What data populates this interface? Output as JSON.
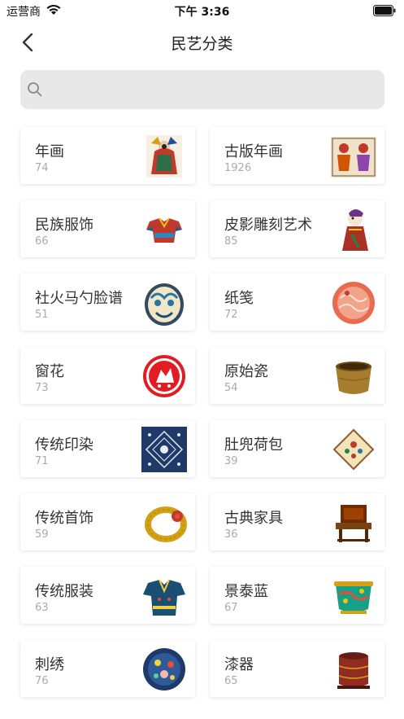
{
  "status_bar": {
    "carrier": "运营商",
    "time": "下午 3:36"
  },
  "nav": {
    "title": "民艺分类",
    "back_icon": "chevron-left-icon"
  },
  "search": {
    "placeholder": "",
    "icon": "search-icon"
  },
  "categories": [
    {
      "name": "年画",
      "count": "74",
      "thumb": "new-year-painting"
    },
    {
      "name": "古版年画",
      "count": "1926",
      "thumb": "ancient-woodblock-print"
    },
    {
      "name": "民族服饰",
      "count": "66",
      "thumb": "ethnic-costume"
    },
    {
      "name": "皮影雕刻艺术",
      "count": "85",
      "thumb": "shadow-puppet"
    },
    {
      "name": "社火马勺脸谱",
      "count": "51",
      "thumb": "ladle-mask"
    },
    {
      "name": "纸笺",
      "count": "72",
      "thumb": "paper-letter"
    },
    {
      "name": "窗花",
      "count": "73",
      "thumb": "paper-cut"
    },
    {
      "name": "原始瓷",
      "count": "54",
      "thumb": "primitive-porcelain"
    },
    {
      "name": "传统印染",
      "count": "71",
      "thumb": "indigo-print"
    },
    {
      "name": "肚兜荷包",
      "count": "39",
      "thumb": "pouch"
    },
    {
      "name": "传统首饰",
      "count": "59",
      "thumb": "bracelet"
    },
    {
      "name": "古典家具",
      "count": "36",
      "thumb": "chair"
    },
    {
      "name": "传统服装",
      "count": "63",
      "thumb": "robe"
    },
    {
      "name": "景泰蓝",
      "count": "67",
      "thumb": "cloisonne"
    },
    {
      "name": "刺绣",
      "count": "76",
      "thumb": "embroidery"
    },
    {
      "name": "漆器",
      "count": "65",
      "thumb": "lacquerware"
    }
  ]
}
